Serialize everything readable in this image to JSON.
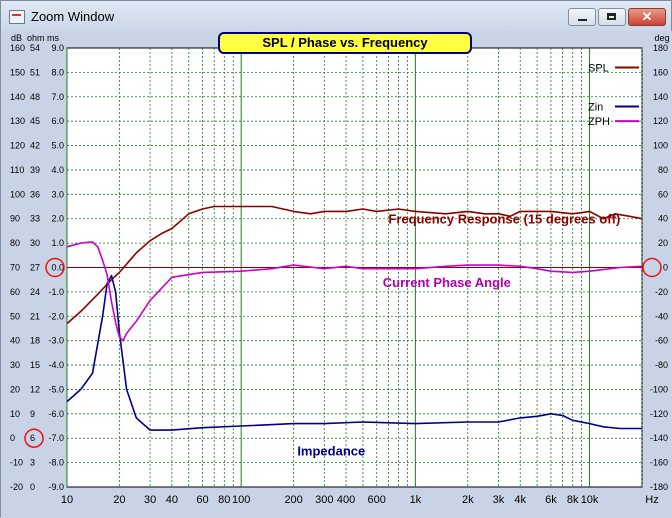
{
  "window": {
    "title": "Zoom Window",
    "min_icon": "minimize-icon",
    "max_icon": "maximize-icon",
    "close_icon": "close-icon",
    "close_glyph": "✕"
  },
  "chart_data": {
    "type": "line",
    "title": "SPL / Phase vs. Frequency",
    "x_scale": "log",
    "xlim": [
      10,
      20000
    ],
    "x_tick_labels": [
      {
        "v": 10,
        "t": "10"
      },
      {
        "v": 20,
        "t": "20"
      },
      {
        "v": 30,
        "t": "30"
      },
      {
        "v": 40,
        "t": "40"
      },
      {
        "v": 60,
        "t": "60"
      },
      {
        "v": 80,
        "t": "80"
      },
      {
        "v": 100,
        "t": "100"
      },
      {
        "v": 200,
        "t": "200"
      },
      {
        "v": 300,
        "t": "300"
      },
      {
        "v": 400,
        "t": "400"
      },
      {
        "v": 600,
        "t": "600"
      },
      {
        "v": 1000,
        "t": "1k"
      },
      {
        "v": 2000,
        "t": "2k"
      },
      {
        "v": 3000,
        "t": "3k"
      },
      {
        "v": 4000,
        "t": "4k"
      },
      {
        "v": 6000,
        "t": "6k"
      },
      {
        "v": 8000,
        "t": "8k"
      },
      {
        "v": 10000,
        "t": "10k"
      }
    ],
    "x_unit": "Hz",
    "axis_headers": {
      "db": "dB",
      "ohm": "ohm",
      "ms": "ms",
      "deg": "deg"
    },
    "db_ticks": [
      "160",
      "150",
      "140",
      "130",
      "120",
      "110",
      "100",
      "90",
      "80",
      "70",
      "60",
      "50",
      "40",
      "30",
      "20",
      "10",
      "0",
      "-10",
      "-20"
    ],
    "ohm_ticks": [
      "54",
      "51",
      "48",
      "45",
      "42",
      "39",
      "36",
      "33",
      "30",
      "27",
      "24",
      "21",
      "18",
      "15",
      "12",
      "9",
      "6",
      "3",
      "0"
    ],
    "ms_ticks": [
      "9.0",
      "8.0",
      "7.0",
      "6.0",
      "5.0",
      "4.0",
      "3.0",
      "2.0",
      "1.0",
      "0.0",
      "-1.0",
      "-2.0",
      "-3.0",
      "-4.0",
      "-5.0",
      "-6.0",
      "-7.0",
      "-8.0",
      "-9.0"
    ],
    "deg_ticks": [
      "180",
      "160",
      "140",
      "120",
      "100",
      "80",
      "60",
      "40",
      "20",
      "0",
      "-20",
      "-40",
      "-60",
      "-80",
      "-100",
      "-120",
      "-140",
      "-160",
      "-180"
    ],
    "grid": true,
    "legend_placement": "top-right",
    "legend": [
      {
        "name": "SPL",
        "color": "#8b0000"
      },
      {
        "name": "Zin",
        "color": "#00008b"
      },
      {
        "name": "ZPH",
        "color": "#cc00cc"
      }
    ],
    "annotations": [
      {
        "text": "Frequency Response (15 degrees off)",
        "color": "#8b0000",
        "x": 700,
        "deg": 36
      },
      {
        "text": "Current Phase Angle",
        "color": "#b000b0",
        "x": 650,
        "deg": -16
      },
      {
        "text": "Impedance",
        "color": "#00008b",
        "x": 210,
        "deg": -154
      }
    ],
    "highlight_ticks": [
      "0.0",
      "6",
      "0"
    ],
    "series": [
      {
        "name": "SPL",
        "axis": "dB",
        "color": "#8b0000",
        "x": [
          10,
          12,
          15,
          18,
          20,
          25,
          30,
          35,
          40,
          50,
          60,
          70,
          80,
          100,
          150,
          200,
          250,
          300,
          400,
          500,
          600,
          800,
          1000,
          1500,
          2000,
          2500,
          3000,
          3500,
          4000,
          5000,
          6000,
          8000,
          10000,
          12000,
          14000,
          17000,
          20000
        ],
        "y": [
          47,
          52,
          59,
          65,
          68,
          76,
          81,
          84,
          86,
          92,
          94,
          95,
          95,
          95,
          95,
          93,
          92,
          93,
          93,
          94,
          93,
          94,
          93,
          92,
          93,
          92,
          92,
          91,
          93,
          93,
          93,
          92,
          93,
          90,
          92,
          91,
          90
        ]
      },
      {
        "name": "Zin",
        "axis": "ohm",
        "color": "#00008b",
        "x": [
          10,
          12,
          14,
          16,
          17,
          18,
          19,
          20,
          22,
          25,
          30,
          40,
          60,
          100,
          200,
          300,
          500,
          1000,
          2000,
          3000,
          4000,
          5000,
          6000,
          7000,
          8000,
          10000,
          12000,
          15000,
          20000
        ],
        "y": [
          7.5,
          9,
          11,
          18,
          22,
          23,
          21,
          16,
          9,
          5.5,
          4,
          4,
          4.3,
          4.5,
          4.8,
          4.8,
          5,
          4.8,
          5,
          5,
          5.5,
          5.7,
          6,
          5.8,
          5.2,
          4.8,
          4.4,
          4.2,
          4.2
        ],
        "ohm_offset": 3
      },
      {
        "name": "ZPH",
        "axis": "deg",
        "color": "#cc00cc",
        "x": [
          10,
          12,
          14,
          15,
          16,
          17,
          18,
          19,
          20,
          21,
          22,
          25,
          30,
          40,
          60,
          100,
          150,
          200,
          300,
          400,
          500,
          700,
          1000,
          1500,
          2000,
          3000,
          4000,
          5000,
          6000,
          8000,
          10000,
          15000,
          20000
        ],
        "y": [
          17,
          20,
          21,
          17,
          6,
          -6,
          -28,
          -45,
          -57,
          -60,
          -54,
          -44,
          -27,
          -8,
          -4,
          -3,
          -1,
          2,
          -1,
          1,
          -1,
          -1,
          -1,
          1,
          2,
          2,
          1,
          -1,
          -3,
          -4,
          -3,
          0,
          1
        ]
      }
    ]
  }
}
